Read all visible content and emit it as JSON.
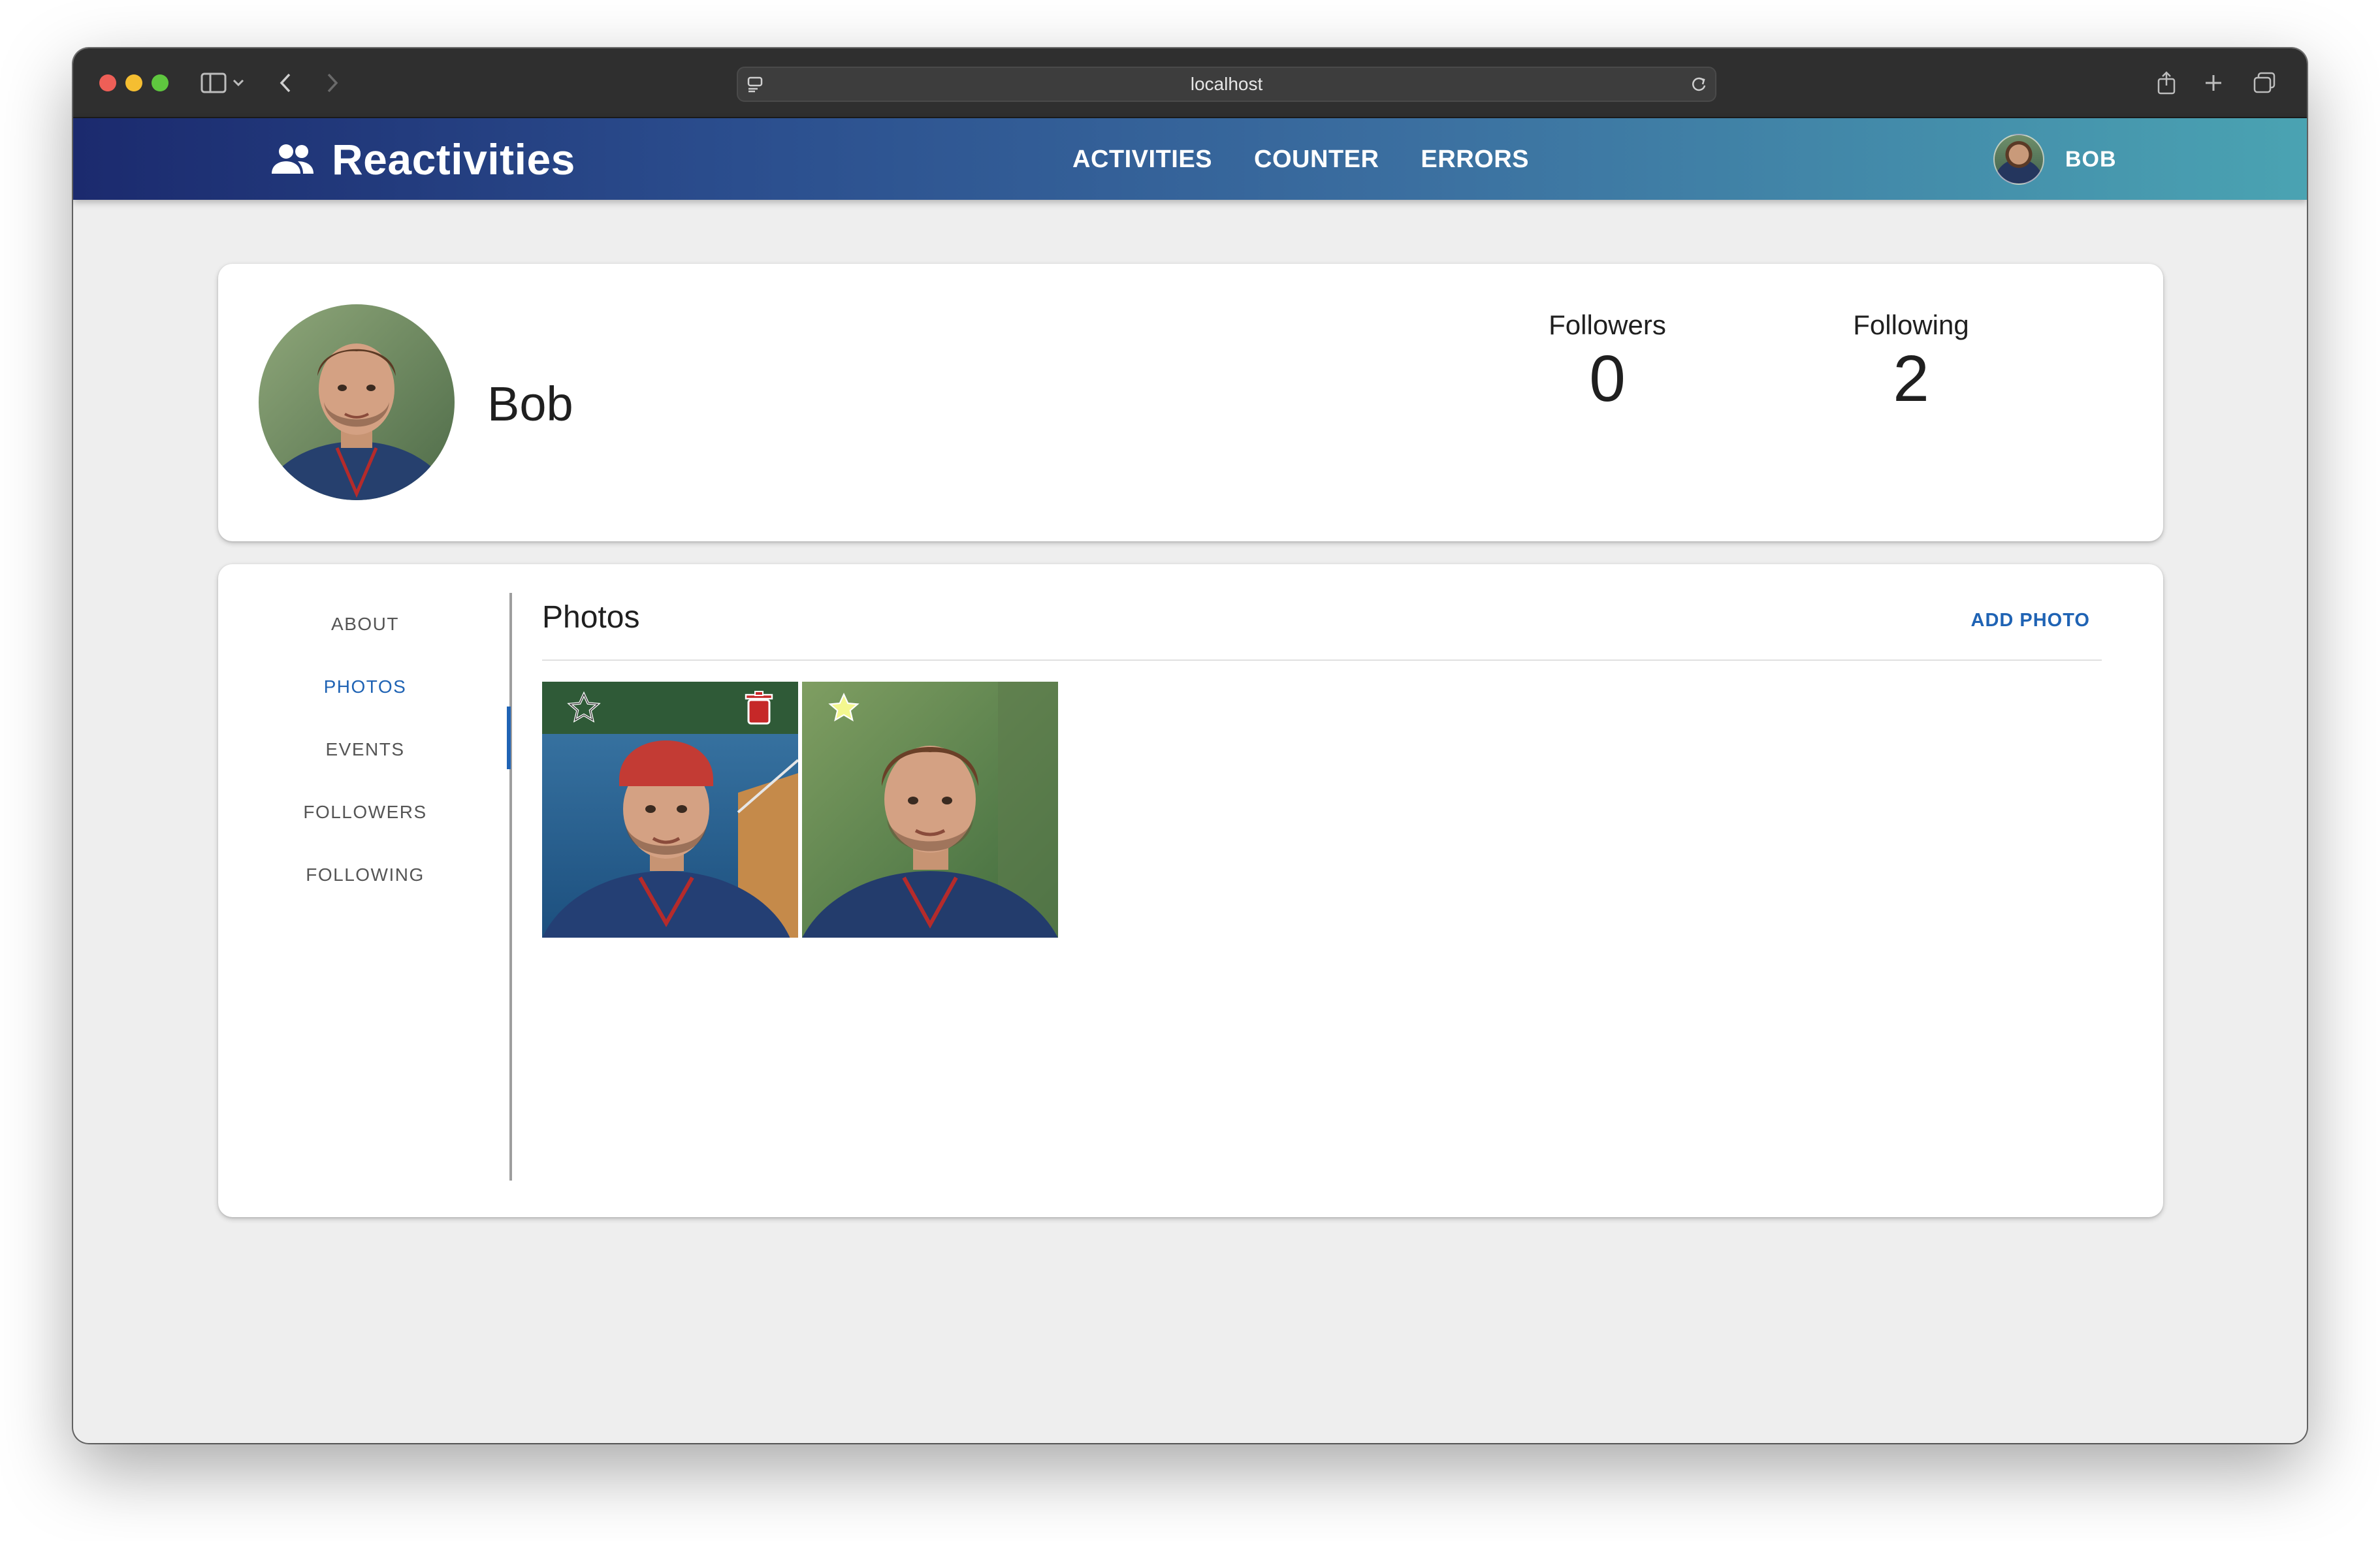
{
  "browser": {
    "url": "localhost"
  },
  "app": {
    "brand_name": "Reactivities",
    "nav": [
      "ACTIVITIES",
      "COUNTER",
      "ERRORS"
    ],
    "user": {
      "name": "BOB"
    }
  },
  "profile": {
    "display_name": "Bob",
    "followers": {
      "label": "Followers",
      "count": "0"
    },
    "following": {
      "label": "Following",
      "count": "2"
    }
  },
  "tabs": [
    "ABOUT",
    "PHOTOS",
    "EVENTS",
    "FOLLOWERS",
    "FOLLOWING"
  ],
  "active_tab": "PHOTOS",
  "photos_panel": {
    "title": "Photos",
    "add_button": "ADD PHOTO",
    "photos": [
      {
        "is_main": false,
        "has_delete": true,
        "scene": "lake with boat, red cap"
      },
      {
        "is_main": true,
        "has_delete": false,
        "scene": "park background"
      }
    ]
  },
  "colors": {
    "accent": "#1f63b4",
    "header_gradient_start": "#1b2a6e",
    "header_gradient_end": "#4aa3b2",
    "main_star": "#f3f78f",
    "delete": "#c62828"
  }
}
